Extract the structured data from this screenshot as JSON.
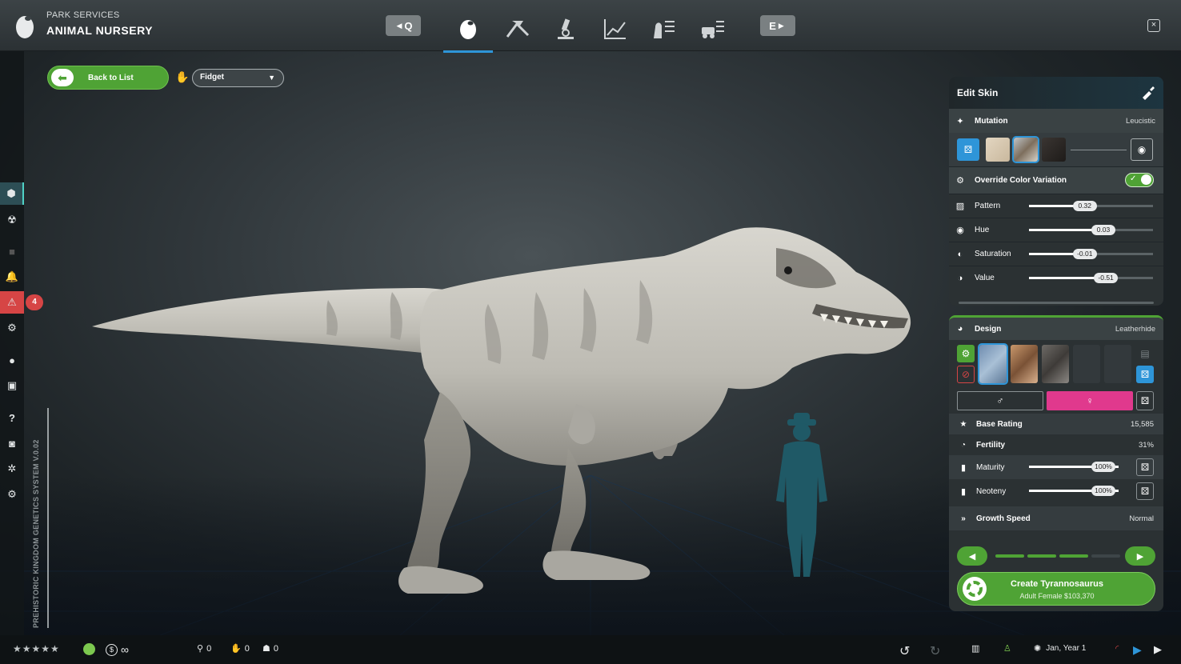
{
  "header": {
    "subtitle": "PARK SERVICES",
    "title": "ANIMAL NURSERY",
    "key_left": "Q",
    "key_right": "E",
    "close": "×"
  },
  "nav_tabs": [
    {
      "icon": "egg-icon",
      "active": true
    },
    {
      "icon": "fossil-dig-icon",
      "active": false
    },
    {
      "icon": "microscope-icon",
      "active": false
    },
    {
      "icon": "chart-icon",
      "active": false
    },
    {
      "icon": "dinosaur-list-icon",
      "active": false
    },
    {
      "icon": "vehicle-list-icon",
      "active": false
    }
  ],
  "left_rail": {
    "warning_count": "4",
    "vertical_text": "PREHISTORIC KINGDOM GENETICS SYSTEM V.0.02"
  },
  "controls": {
    "back_label": "Back to List",
    "animation_select": "Fidget"
  },
  "edit_skin": {
    "title": "Edit Skin",
    "mutation_label": "Mutation",
    "mutation_value": "Leucistic",
    "override_label": "Override Color Variation",
    "override_on": true,
    "sliders": [
      {
        "label": "Pattern",
        "value": "0.32",
        "fraction": 0.45
      },
      {
        "label": "Hue",
        "value": "0.03",
        "fraction": 0.6
      },
      {
        "label": "Saturation",
        "value": "-0.01",
        "fraction": 0.45
      },
      {
        "label": "Value",
        "value": "-0.51",
        "fraction": 0.62
      }
    ]
  },
  "design": {
    "label": "Design",
    "value": "Leatherhide",
    "male_symbol": "♂",
    "female_symbol": "♀",
    "base_rating_label": "Base Rating",
    "base_rating_value": "15,585",
    "fertility_label": "Fertility",
    "fertility_value": "31%",
    "maturity_label": "Maturity",
    "maturity_value": "100%",
    "maturity_fraction": 1.0,
    "neoteny_label": "Neoteny",
    "neoteny_value": "100%",
    "neoteny_fraction": 1.0,
    "growth_label": "Growth Speed",
    "growth_value": "Normal",
    "growth_level": 3,
    "growth_max": 4,
    "create_label": "Create Tyrannosaurus",
    "create_sub": "Adult Female $103,370"
  },
  "bottom": {
    "stars": "★★★★★",
    "currency": "∞",
    "count_a": "0",
    "count_b": "0",
    "count_c": "0",
    "date": "Jan, Year 1"
  },
  "colors": {
    "accent_green": "#4fa335",
    "accent_blue": "#2e95d8",
    "female_pink": "#e0398d",
    "warn_red": "#d64545",
    "silhouette_teal": "#1f5966"
  }
}
